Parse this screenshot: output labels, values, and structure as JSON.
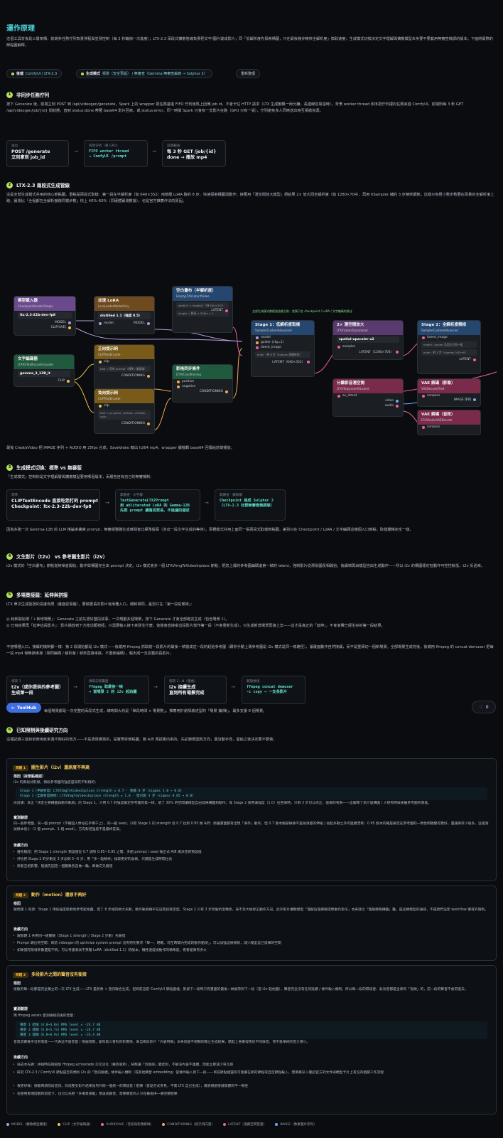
{
  "title": "運作原理",
  "intro": "這個工具背後是三層架構：前端參任務佇列負責排程與並發控制（每 3 秒輪詢一次進度）；LTX-2.3 兩段式擴散管線負責把文字/圖片變成影片；同「低解析度先探索構圖，只在最後幾步精修全解析度」換取速度；生成模式切換決定文字理解與擴散模型本身要不要套用無審查微調的版本。下面將實際的節點圖解釋。",
  "chips": [
    {
      "label": "後端",
      "value": "ComfyUI / LTX-2.3",
      "color": "#b7e35a"
    },
    {
      "label": "生成模式",
      "value": "標準（安全預設） / 無審查（Gemma 無審查編寫 → Sulphur 2）",
      "color": "#b7e35a"
    },
    {
      "label": "",
      "value": "重新整理",
      "color": ""
    }
  ],
  "s1": {
    "num": "1",
    "title": "非同步任務佇列",
    "body": "按下 Generate 後，前端立刻 POST 到 /api/videogen/generate，Spark 上的 wrapper 把任務塞進 FIFO 佇列後馬上回傳 job id，不會卡住 HTTP 請求（LTX 生成動輒一兩分鐘，長連線容易逾時）。背景 worker thread 依序把佇列裡的任務丟進 ComfyUI，前端則每 3 秒 GET /api/videogen/job/{id} 問狀態，直到 status:done 帶著 base64 影片回來，或 status:error。同一時間 Spark 只會有一支影片在跑（GPU 只有一張），佇列避免多人同時送出時互相搶資源。",
    "flow": [
      {
        "label": "送出",
        "value": "POST /generate\n立刻拿到 job_id",
        "code": false
      },
      {
        "label": "背景佇列（單 GPU）",
        "value": "FIFO worker thread\n→ ComfyUI /prompt",
        "code": true
      },
      {
        "label": "前端輪詢",
        "value": "每 3 秒 GET /job/{id}\ndone → 播放 mp4",
        "code": false
      }
    ]
  },
  "s2": {
    "num": "2",
    "title": "LTX-2.3 兩段式生成管線",
    "body": "這是全部生成模式共用的核心節點圖。重點是兩段式取樣：第一段在半解析度（如 640×352）用蒸餾 LoRA 跑約 8 步，快速探索構圖與動作；接著用「潛空間放大模型」把結果 2× 放大回全解析度（如 1280×704），再用 KSampler 補約 3 步精修細節。這樣只有極少數步數要在昂貴的全解析度上跑，實測比「全程都在全解析度跑同樣步數」快上 40%–60%（同硬體實測數據），也是官方推薦作法的原因。",
    "footer": "最後 CreateVideo 把 IMAGE 序列 + AUDIO 用 25fps 合成，SaveVideo 輸出 h264 mp4，wrapper 讀檔轉 base64 回傳給前端播放。"
  },
  "graph": {
    "note": "全部生成模式都經過這條主幹；差異只在 checkpoint / LoRA / 文字編碼的換法",
    "nodes": {
      "ckpt": {
        "title": "模型載入器",
        "sub": "CheckpointLoaderSimple",
        "widget": "ltx-2.3-22b-dev-fp8",
        "out1": "MODEL",
        "out2": "CLIP(VAE)"
      },
      "lora": {
        "title": "加速 LoRA",
        "sub": "LoraLoaderModelOnly",
        "widget": "distilled 1.1（強度 0.5）",
        "in1": "model",
        "out1": "MODEL"
      },
      "latent": {
        "title": "空白畫布（半解析度）",
        "sub": "EmptyLTXVLatentVideo",
        "w1": "width/2 × height/2（例 640×352）",
        "w2": "length = 影長 × 25fps + 1",
        "out1": "LATENT"
      },
      "textenc": {
        "title": "文字編碼器",
        "sub": "LTXAVTextEncoderLoader",
        "widget": "gemma_3_12B_it",
        "out1": "CLIP"
      },
      "pos": {
        "title": "正向提示詞",
        "sub": "CLIPTextEncode",
        "in1": "clip",
        "w1": "text = 您的 prompt（標準 / 擴展後）",
        "out1": "CONDITIONING"
      },
      "neg": {
        "title": "負向提示詞",
        "sub": "CLIPTextEncode",
        "in1": "clip",
        "w1": "text = pc game, cartoon, childish, ugly...",
        "out1": "CONDITIONING"
      },
      "cond": {
        "title": "影格同步條件",
        "sub": "LTXVConditioning",
        "in1": "positive",
        "in2": "negative",
        "out1": "CONDITIONING"
      },
      "stage1": {
        "title": "Stage 1：低解析度取樣",
        "sub": "SamplerCustomAdvanced",
        "in1": "model",
        "in2": "guider (cfg=1)",
        "in3": "latent_image",
        "w1": "euler · 約 8 步（sigmas 蒸餾排程）",
        "out1": "LATENT（640×352）"
      },
      "upscale": {
        "title": "2× 潛空間放大",
        "sub": "LTXVLatentUpsampler",
        "widget": "spatial-upscaler-x2",
        "in1": "samples",
        "out1": "LATENT（1280×704）"
      },
      "stage2": {
        "title": "Stage 2：全解析度精修",
        "sub": "SamplerCustomAdvanced",
        "in1": "latent_image",
        "w1": "model / guider 沿用左方同一組",
        "w2": "euler · 約 3 步（sigmas 0.85→0）",
        "out1": "LATENT"
      },
      "split": {
        "title": "分離影音潛空間",
        "sub": "LTXVSeparateAVLatent",
        "in1": "av_latent",
        "out1": "video",
        "out2": "audio"
      },
      "vaev": {
        "title": "VAE 解碼（影像）",
        "sub": "VAEDecodeTiled",
        "in1": "samples",
        "out1": "IMAGE 序列"
      },
      "vaea": {
        "title": "VAE 解碼（音訊）",
        "sub": "LTXVAudioVAEDecode",
        "in1": "samples"
      }
    }
  },
  "s3": {
    "num": "3",
    "title": "生成模式切換：標準 vs 無審版",
    "body": "「生成模式」控制的是文字理解層與擴散模型要用哪個版本，兩層各自有自己的無審機制：",
    "flow": [
      {
        "label": "標準",
        "value": "CLIPTextEncode 直接吃您打的 prompt\nCheckpoint：ltx-2.3-22b-dev-fp8",
        "code": false
      },
      {
        "label": "無審查 · 文字層",
        "value": "TextGenerateLTX2Prompt\n用 abliterated LoRA 的 Gemma-12B\n先把 prompt 擴寫成更長、不過濾的描述",
        "code": true
      },
      {
        "label": "無審查 · 擴散層",
        "value": "Checkpoint 換成 Sulphur 2\n（LTX-2.3 社群無審查微調版）",
        "code": true
      }
    ],
    "footer": "因為多跑一次 Gemma-12B 的 LLM 推論來擴寫 prompt，無審版整體生成時間會比標準版長（多出一段文字生成的等待）。兩種模式共用上面同一張兩段式取樣節點圖，差別只在 Checkpoint / LoRA / 文字編碼這幾個入口節點，取樣邏輯完全一樣。"
  },
  "s4": {
    "num": "4",
    "title": "文生影片（t2v） vs 參考圖生影片（i2v）",
    "body": "t2v 模式的「空白畫布」節點從純噪音開始，動作與構圖完全由 prompt 決定。i2v 模式會多一個 LTXVImgToVideoInplace 節點，把您上傳的參考圖編碼進第一幀的 latent，強制影片從那張圖長相開始，後續幀再由模型自由生成動作——所以 i2v 的構圖穩定但動作可控性較低，t2v 反過來。"
  },
  "s5": {
    "num": "5",
    "title": "多場景接龍：延伸與拼接",
    "body1": "LTX 單次生成能撐的長度有限（畫面容易崩），要做更長的影片有兩種入口，機制相同，差別只在「第一段從哪來」：",
    "body2": "◎ 純新開始場「＋新增場景」：Generate 之前先想好整段故事，一次規劃多個場景，按下 Generate 才會全部跑完生成（包含場景 1）。\n◎ 已有結果再「延伸這段影片」：影片播放到下方按這顆按鈕，只需要輸入接下來發生什麼，後端會直接拿這段影片當作第一段（不會重新生成），只生成新增場景再接上去——這才是真正的「延伸」，不會浪費已經生好的第一段結果。",
    "body3": "不管哪種入口，接續的機制都一樣：第 2 段開始都是 i2v 模式——後端用 ffmpeg 抓取前一段影片的最後一幀當成這一段的起始參考圖（跟你手動上傳參考圖是 i2v 模式是同一條路徑），讓畫面動作自然接續，而不是重頭切一個新場景。全部場景生成完後，後端用 ffmpeg 的 concat demuxer 把每一段 mp4 做無損串接（相同編碼 / 解析度 / 幀率直接串接，不重新編碼），輸出成一支完整的長影片。",
    "flow": [
      {
        "label": "場景 1",
        "value": "t2v（或你提供的參考圖）\n生成第一段",
        "code": false
      },
      {
        "label": "擷取前場畫面",
        "value": "ffmpeg 取最後一幀\n→ 當場景 2 的 i2v 起始圖",
        "code": true
      },
      {
        "label": "場景 2...N（重複）",
        "value": "i2v 接續生成\n直到所有場景完成",
        "code": false
      },
      {
        "label": "無損拼接",
        "value": "ffmpeg concat demuxer\n-c copy → 一支長影片",
        "code": true
      }
    ],
    "footer": "每個場景都是一次完整的兩段式生成，總時間大約是「單段時間 × 場景數」。推薦用於劇情敘述型的「場景 鋪/陳」，最多支援 8 個場景。"
  },
  "toolhub": "ToolHub",
  "likes": "0",
  "s6": {
    "num": "6",
    "title": "已知限制與後續研究方向",
    "body": "這裡記錄三個目前使用就來還不夠好的地方——不是憑感覺猜的，是實際拆節點圖、跑 A/B 測試量出來的。先記錄根因與方向，還沒動手改，留給之後決定要不要做。"
  },
  "p1": {
    "tag": "問題 1",
    "title": "圖生影片（i2v）還原度不夠高",
    "h1": "根因（拆節點確認）",
    "t1": "i2v 的兩段式取樣，兩段參考圖的強度是寫死不對稱的：",
    "code": "Stage 1（半解析度）LTXVImgToVideoInplace strength = 0.7 · 蒸餾 8 步（sigmas 1.0 → 0.0）\nStage 2（全解析度精修）LTXVImgToVideoInplace strength = 1.0 · 但只跑 3 步（sigmas 0.85 → 0.0）",
    "t2": "白話講：真正「決定主要構圖與動作軌跡」的 Stage 1，只用 0.7 的強度鎖定參考圖的第一幀，留了 30% 的空間讓模型自由發揮構圖和動作；等 Stage 2 想用滿強度（1.0）拉回來時，只剩 3 步可以修正，能做的有限——這解釋了為什麼構圖 / 人物有時候會離參考圖有落差。",
    "h2": "實測驗證",
    "t3": "同一張參考圖、同一個 prompt（不穩固人像站在手塚干上）、同一組 seed，只把 Stage 1 的 strength 從 0.7 拉到 0.95 做 A/B：兩邊畫面都有出現「滑手」動作，但 0.7 版本臉部線條不是很清楚的伸縮 / 站起多數之外的連續漂移；0.95 版本的確是鎖定在參考圖的一致性明顯變得更好，還讓保存少很多。這組測試樣本很小（1 個 prompt、1 組 seed），方向對但強度不是最終答案。",
    "h3": "後續方向",
    "items": [
      "優先驗證：把 Stage 1 strength 預設值從 0.7 調到 0.85~0.95 之間，多組 prompt / seed 做正式 A/B 再決定新預設值",
      "評估把 Stage 2 的步數從 3 步加到 5~6 步，用「多一點精修」換取更好的收斂，代價是生成時間拉長",
      "兩者互相影響，建議先固定一個變數各自做一輪，再做交叉驗證"
    ]
  },
  "p2": {
    "tag": "問題 2",
    "title": "動作（motion）還原不夠好",
    "h1": "根因",
    "t1": "跟問題 1 同源：Stage 1 用低強度鬆軟地參考起始圖，但了 8 步裡的絕大多數，動作軌跡幾乎在這階段就定型。Stage 2 只有 3 步高解析度精修，來不及大幅修正動作方向。此外影片擴散模型「理解這個要動得像動作指令」本身就比「理解靜態構圖」難，是這類模型的通病，不是我們這套 workflow 獨有的限制。",
    "h2": "後續方向",
    "items": [
      "跟問題 1 共用同一組實驗（Stage 1 strength / Stage 2 步數）先驗證",
      "Prompt 端也有空間：目前 videogen 的 optimize system prompt 沒有特別要求「單一、明確、可在時間內完成的動作動詞」，可以加強這條規則，減少模型自己發揮的空間",
      "如果調完取樣參數還是不夠，可以考慮測試不蒸餾 LoRA（distilled 1.1）的版本，犧牲速度換動作的精準度，看看差異有多大"
    ]
  },
  "p3": {
    "tag": "問題 3",
    "title": "多段影片之間的聲音沒有銜接",
    "h1": "根因",
    "t1": "接龍的每一段都是完全獨立的一次 LTX 生成——LTX 是影像 + 音訊聯合生成，但目前這套 ComfyUI 節點圖裡，影接下一段時只有畫面的最後一幀被帶到下一段（當 i2v 起始圖），聲音完全沒有任何延續 / 條件輸入機制。所以每一段的環境音、氣氛音都是全新的「從頭」的，前一段的聲音不會帶過去。",
    "h2": "實測驗證",
    "t2": "用 ffmpeg astats 量測接縫前後的音量：",
    "code": "場景 1 結尾（4.0~4.8s）RMS level = -24.7 dB\n場景 2 開頭（4.0~5.7s）RMS level = -24.7 dB\n場景 3 開頭（6.0~6.9s）RMS level = -24.4 dB",
    "t3": "音量其實幾乎沒有落差——代表這不是音量 / 增益問題，是和第三者對的影響感，來自兩段影片「內容特徵」本身就是不相關的獨立生成結果，聽起上會覺得像從不同錄音，而不是單純的音大落小。",
    "h3": "後續方向",
    "items": [
      "低成本先做：拼接時在接縫加 ffmpeg acrossfade 交叉淡化（幾百毫秒），純粹讓「切換感」變柔和，不解決內容不連續，但能立即減少突兀感",
      "研究 LTX-2.3 / ComfyUI 節點是否有類似 i2v 的「音訊接續」條件輸入機制（或其他聲音 embedding）當條件輸入到下一段——目前節點裡還有可能藏在新的節點或自定節點輸入，需要再深入確認官方的文件與模型卡片上有沒有相關工作流程",
      "根更好做：接龍時請前段音訊，改成整支影片結束後另外跑一個統一的環境音 / 配樂（音點方式參見，不需 LTX 自己生成），徹底規避接縫問題的不一致性",
      "在使用者端提醒的前提下，也可以先把「多場景接龍」預設成靜音，需要聲音的人只在最後拼一條完整配樂"
    ]
  },
  "legend": [
    {
      "label": "MODEL（擴散模型權重）",
      "color": "#b39ddb"
    },
    {
      "label": "CLIP（文字編碼器）",
      "color": "#f2c14e"
    },
    {
      "label": "AUDIO/VAE（音訊與影像解碼）",
      "color": "#ef6f8a"
    },
    {
      "label": "CONDITIONING（提示詞向量）",
      "color": "#f3a85b"
    },
    {
      "label": "LATENT（潛藏空間張量）",
      "color": "#ef5fa7"
    },
    {
      "label": "IMAGE（像素圖片序列）",
      "color": "#6fa8ff"
    }
  ]
}
